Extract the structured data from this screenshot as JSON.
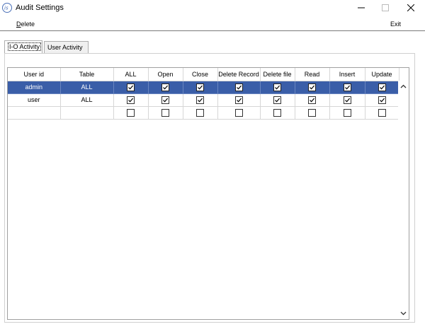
{
  "window": {
    "title": "Audit Settings",
    "app_icon": "is-logo-icon"
  },
  "menu": {
    "delete_label": "Delete",
    "delete_accel": "D",
    "delete_rest": "elete",
    "exit_label": "Exit"
  },
  "tabs": [
    {
      "label": "I-O Activity",
      "active": true
    },
    {
      "label": "User Activity",
      "active": false
    }
  ],
  "grid": {
    "columns": [
      "User id",
      "Table",
      "ALL",
      "Open",
      "Close",
      "Delete Record",
      "Delete file",
      "Read",
      "Insert",
      "Update"
    ],
    "rows": [
      {
        "user_id": "admin",
        "table": "ALL",
        "checks": [
          true,
          true,
          true,
          true,
          true,
          true,
          true,
          true
        ],
        "selected": true
      },
      {
        "user_id": "user",
        "table": "ALL",
        "checks": [
          true,
          true,
          true,
          true,
          true,
          true,
          true,
          true
        ],
        "selected": false
      },
      {
        "user_id": "",
        "table": "",
        "checks": [
          false,
          false,
          false,
          false,
          false,
          false,
          false,
          false
        ],
        "selected": false
      }
    ]
  },
  "colors": {
    "selection": "#3a5ea8",
    "accent_icon": "#4a70b8"
  }
}
